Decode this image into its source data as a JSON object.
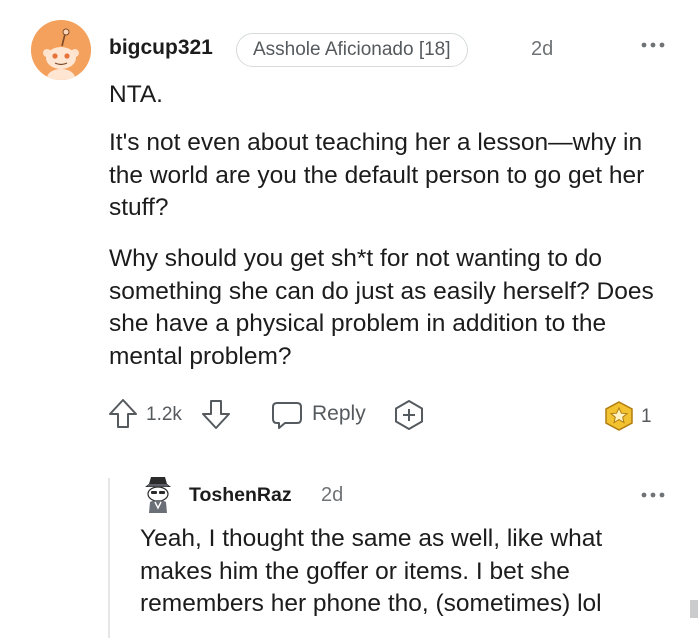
{
  "comment": {
    "username": "bigcup321",
    "flair": "Asshole Aficionado [18]",
    "time": "2d",
    "paragraphs": [
      "NTA.",
      "It's not even about teaching her a lesson—why in the world are you the default person to go get her stuff?",
      "Why should you get sh*t for not wanting to do something she can do just as easily herself? Does she have a physical problem in addition to the mental problem?"
    ],
    "votes": "1.2k",
    "reply_label": "Reply",
    "award_count": "1",
    "icons": {
      "menu": "more-options-icon",
      "upvote": "upvote-arrow-icon",
      "downvote": "downvote-arrow-icon",
      "reply": "speech-bubble-icon",
      "award": "plus-award-icon",
      "badge": "gold-award-icon"
    }
  },
  "reply": {
    "username": "ToshenRaz",
    "time": "2d",
    "text": "Yeah, I thought the same as well, like what makes him the goffer or items. I bet she remembers her phone tho, (sometimes) lol"
  },
  "colors": {
    "avatar_bg": "#f5a15e",
    "award_gold": "#f2c230",
    "text_primary": "#1c1c1c",
    "text_muted": "#6f7376"
  }
}
